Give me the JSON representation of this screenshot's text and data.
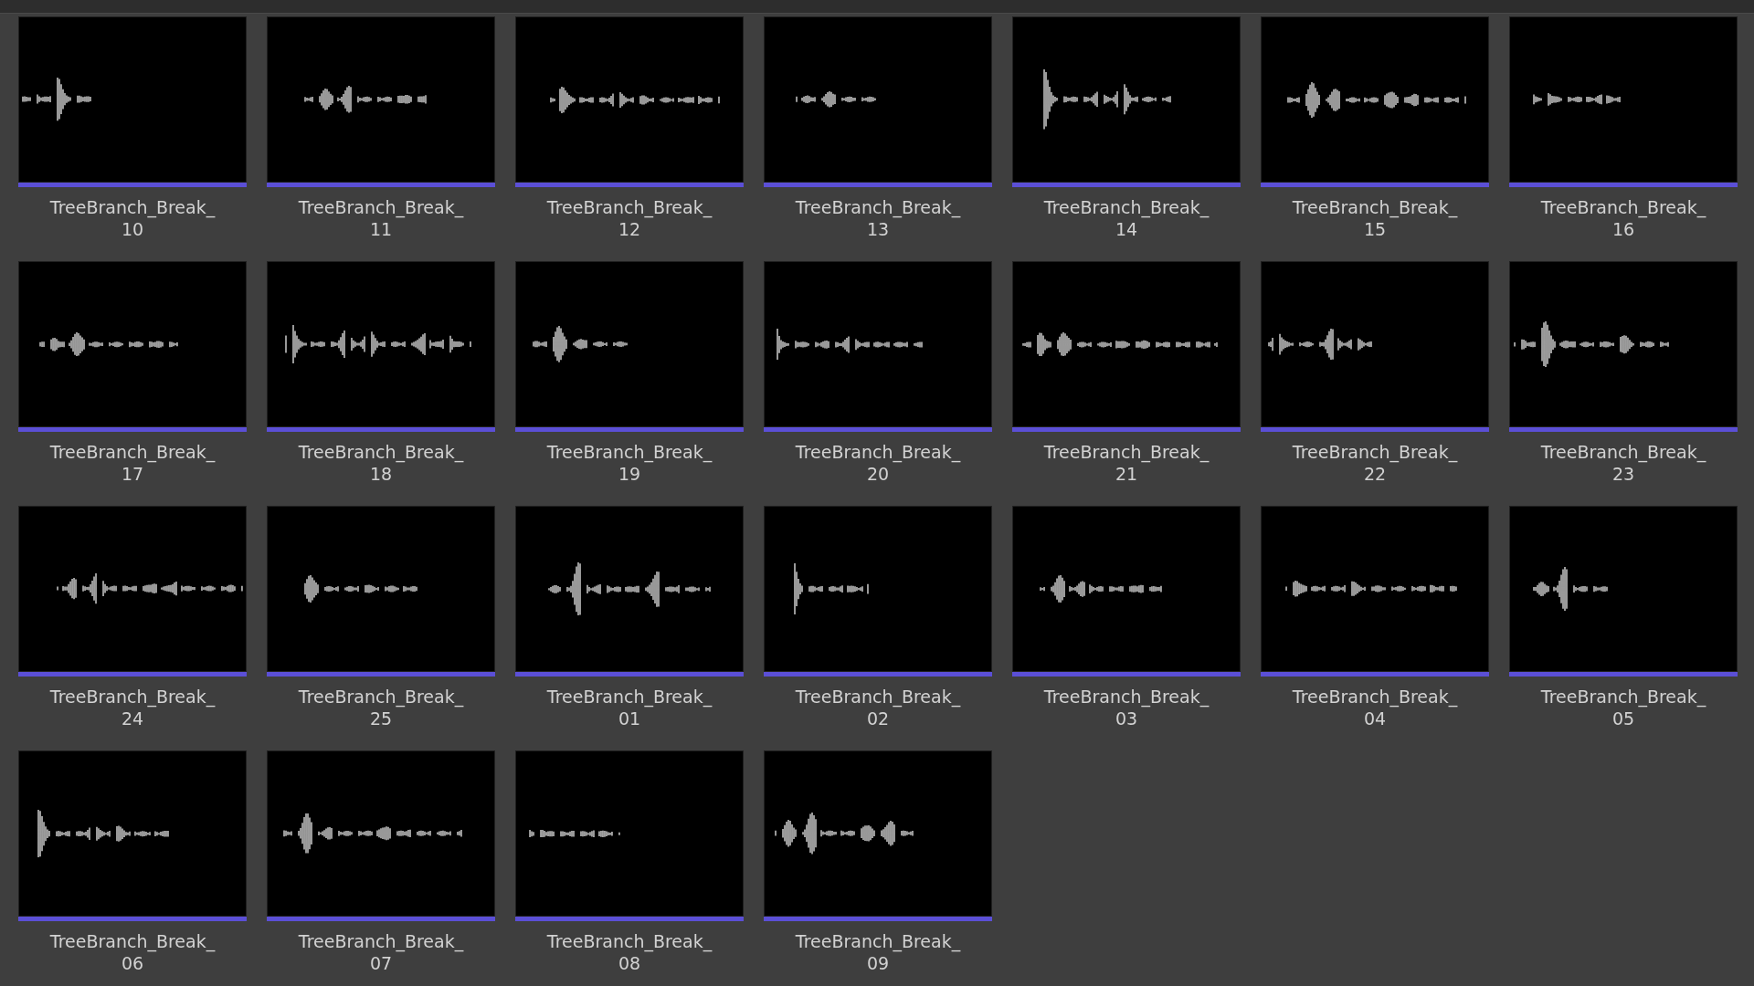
{
  "assets": [
    {
      "line1": "TreeBranch_Break_",
      "line2": "10"
    },
    {
      "line1": "TreeBranch_Break_",
      "line2": "11"
    },
    {
      "line1": "TreeBranch_Break_",
      "line2": "12"
    },
    {
      "line1": "TreeBranch_Break_",
      "line2": "13"
    },
    {
      "line1": "TreeBranch_Break_",
      "line2": "14"
    },
    {
      "line1": "TreeBranch_Break_",
      "line2": "15"
    },
    {
      "line1": "TreeBranch_Break_",
      "line2": "16"
    },
    {
      "line1": "TreeBranch_Break_",
      "line2": "17"
    },
    {
      "line1": "TreeBranch_Break_",
      "line2": "18"
    },
    {
      "line1": "TreeBranch_Break_",
      "line2": "19"
    },
    {
      "line1": "TreeBranch_Break_",
      "line2": "20"
    },
    {
      "line1": "TreeBranch_Break_",
      "line2": "21"
    },
    {
      "line1": "TreeBranch_Break_",
      "line2": "22"
    },
    {
      "line1": "TreeBranch_Break_",
      "line2": "23"
    },
    {
      "line1": "TreeBranch_Break_",
      "line2": "24"
    },
    {
      "line1": "TreeBranch_Break_",
      "line2": "25"
    },
    {
      "line1": "TreeBranch_Break_",
      "line2": "01"
    },
    {
      "line1": "TreeBranch_Break_",
      "line2": "02"
    },
    {
      "line1": "TreeBranch_Break_",
      "line2": "03"
    },
    {
      "line1": "TreeBranch_Break_",
      "line2": "04"
    },
    {
      "line1": "TreeBranch_Break_",
      "line2": "05"
    },
    {
      "line1": "TreeBranch_Break_",
      "line2": "06"
    },
    {
      "line1": "TreeBranch_Break_",
      "line2": "07"
    },
    {
      "line1": "TreeBranch_Break_",
      "line2": "08"
    },
    {
      "line1": "TreeBranch_Break_",
      "line2": "09"
    }
  ]
}
